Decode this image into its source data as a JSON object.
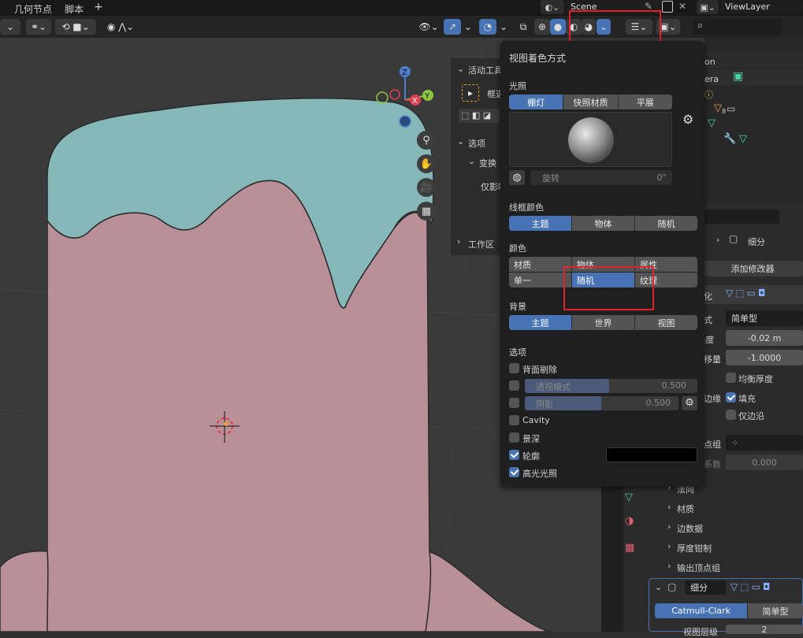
{
  "topbar": {
    "tabs": [
      "几何节点",
      "脚本",
      "+"
    ],
    "scene_label": "Scene",
    "viewlayer_label": "ViewLayer"
  },
  "search": {
    "placeholder": ""
  },
  "toolshelf": {
    "active_tool_header": "活动工具",
    "active_tool_label": "框选",
    "options_header": "选项",
    "transform_header": "变换",
    "only_affect_label": "仅影响",
    "workspace_header": "工作区"
  },
  "gizmo": {
    "z": "Z",
    "y": "Y",
    "x": "X"
  },
  "shading_popup": {
    "title": "视图着色方式",
    "lighting_label": "光照",
    "lighting_options": [
      "棚灯",
      "快照材质",
      "平展"
    ],
    "lighting_selected": 0,
    "rotate_label": "旋转",
    "rotate_value": "0°",
    "wire_color_label": "线框颜色",
    "wire_color_options": [
      "主题",
      "物体",
      "随机"
    ],
    "wire_color_selected": 0,
    "color_label": "颜色",
    "color_options_row1": [
      "材质",
      "物体",
      "属性"
    ],
    "color_options_row2": [
      "单一",
      "随机",
      "纹理"
    ],
    "color_selected": "随机",
    "background_label": "背景",
    "background_options": [
      "主题",
      "世界",
      "视图"
    ],
    "background_selected": 0,
    "options_label": "选项",
    "backface_culling": "背面剔除",
    "xray_label": "透视模式",
    "xray_value": "0.500",
    "shadow_label": "阴影",
    "shadow_value": "0.500",
    "cavity": "Cavity",
    "dof": "景深",
    "outline": "轮廓",
    "specular": "高光光照",
    "outline_checked": true,
    "specular_checked": true
  },
  "outliner": {
    "rows": [
      "on",
      "era",
      "8"
    ]
  },
  "properties": {
    "modifier_name": "细分",
    "add_modifier": "添加修改器",
    "solidify_label": "化",
    "mode_label": "式",
    "mode_value": "简单型",
    "thickness_label": ")度",
    "thickness_value": "-0.02 m",
    "offset_label": "移量",
    "offset_value": "-1.0000",
    "even_thickness": "均衡厚度",
    "rim_label": "边缘",
    "fill": "填充",
    "rim_only": "仅边沿",
    "vgroup_label": "点组",
    "factor_label": "系数",
    "factor_value": "0.000",
    "normals": "法向",
    "materials": "材质",
    "edge_data": "边数据",
    "thickness_clamp": "厚度钳制",
    "output_vgroups": "输出顶点组",
    "subsurf_name": "细分",
    "catmull": "Catmull-Clark",
    "simple": "简单型",
    "viewport_levels": "视图层级",
    "viewport_levels_value": "2"
  }
}
